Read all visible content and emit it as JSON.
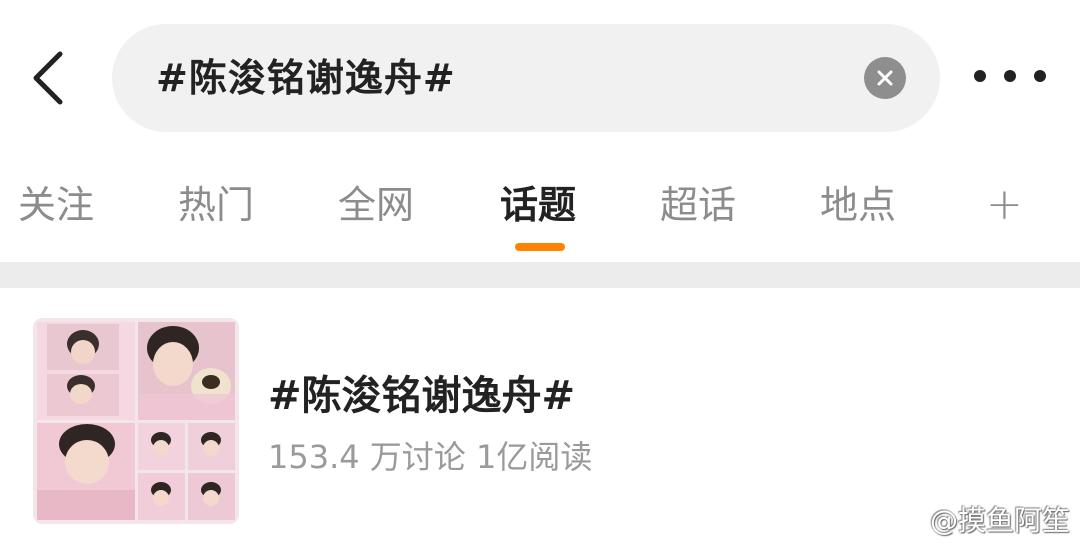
{
  "header": {
    "search_query": "#陈浚铭谢逸舟#",
    "back_icon": "chevron-left-icon",
    "clear_icon": "clear-circle-icon",
    "more_icon": "more-dots-icon"
  },
  "tabs": [
    {
      "label": "关注",
      "active": false
    },
    {
      "label": "热门",
      "active": false
    },
    {
      "label": "全网",
      "active": false
    },
    {
      "label": "话题",
      "active": true
    },
    {
      "label": "超话",
      "active": false
    },
    {
      "label": "地点",
      "active": false
    },
    {
      "label": "+",
      "active": false
    }
  ],
  "accent_color": "#ff8200",
  "topic": {
    "title": "#陈浚铭谢逸舟#",
    "stats": "153.4 万讨论 1亿阅读",
    "thumbnail_icon": "photo-collage-thumbnail"
  },
  "watermark": {
    "text": "@摸鱼阿笙",
    "icon": "weibo-logo-icon"
  }
}
